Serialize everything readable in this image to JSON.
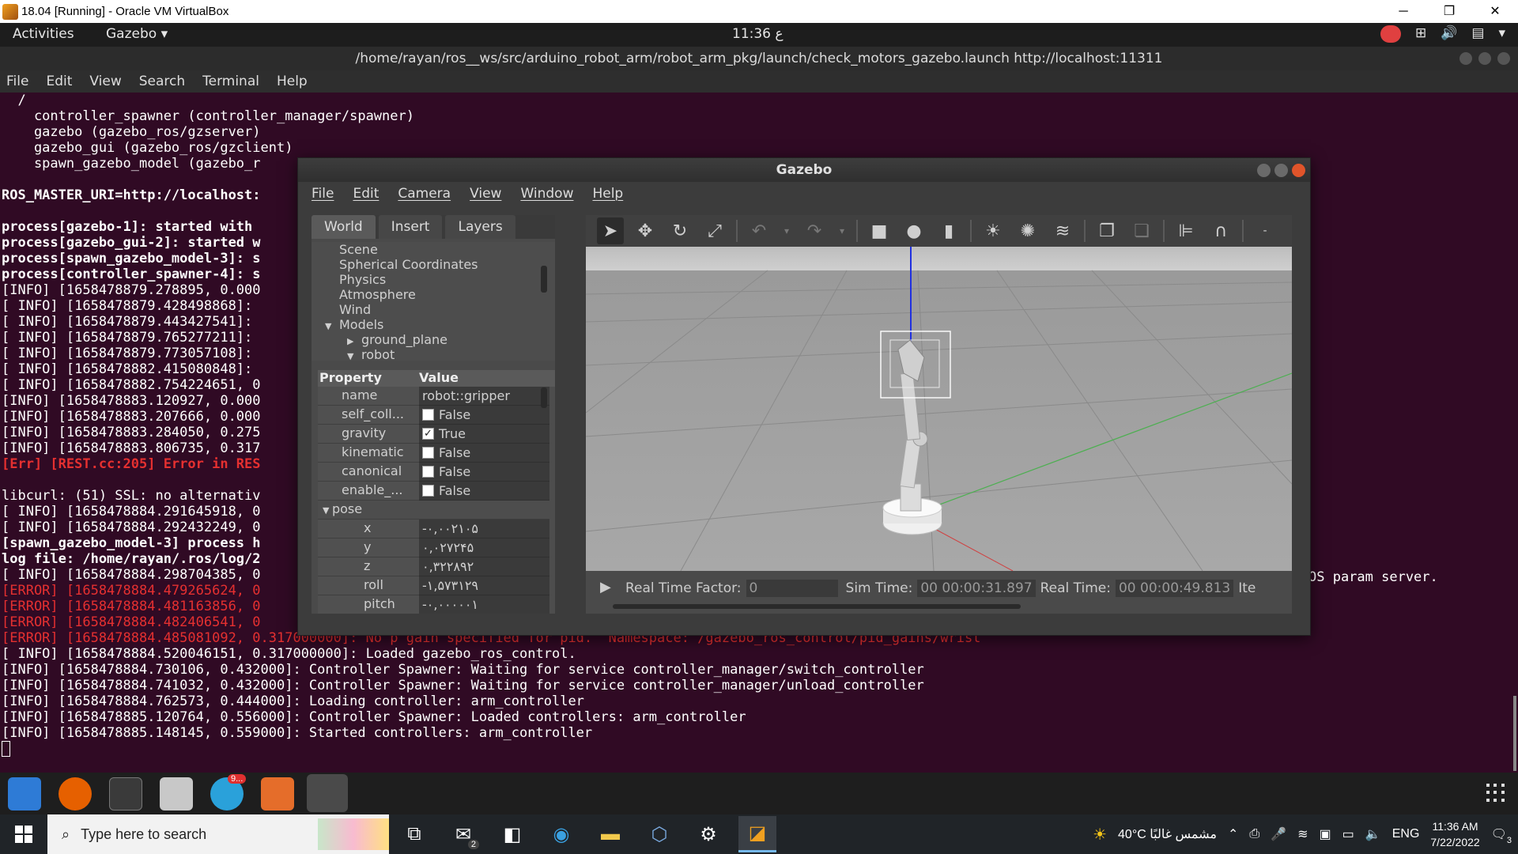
{
  "vbox": {
    "title": "18.04 [Running] - Oracle VM VirtualBox",
    "minimize": "─",
    "restore": "❐",
    "close": "✕"
  },
  "topbar": {
    "activities": "Activities",
    "app_menu": "Gazebo ▾",
    "clock": "11:36 ع",
    "tray_icons": [
      "network-icon",
      "volume-icon",
      "battery-icon",
      "menu-arrow-icon"
    ]
  },
  "terminal": {
    "title": "/home/rayan/ros__ws/src/arduino_robot_arm/robot_arm_pkg/launch/check_motors_gazebo.launch http://localhost:11311",
    "menu": [
      "File",
      "Edit",
      "View",
      "Search",
      "Terminal",
      "Help"
    ],
    "lines": [
      {
        "text": "  /",
        "cls": ""
      },
      {
        "text": "    controller_spawner (controller_manager/spawner)",
        "cls": ""
      },
      {
        "text": "    gazebo (gazebo_ros/gzserver)",
        "cls": ""
      },
      {
        "text": "    gazebo_gui (gazebo_ros/gzclient)",
        "cls": ""
      },
      {
        "text": "    spawn_gazebo_model (gazebo_r",
        "cls": ""
      },
      {
        "text": "",
        "cls": ""
      },
      {
        "text": "ROS_MASTER_URI=http://localhost:",
        "cls": "bold"
      },
      {
        "text": "",
        "cls": ""
      },
      {
        "text": "process[gazebo-1]: started with",
        "cls": "bold"
      },
      {
        "text": "process[gazebo_gui-2]: started w",
        "cls": "bold"
      },
      {
        "text": "process[spawn_gazebo_model-3]: s",
        "cls": "bold"
      },
      {
        "text": "process[controller_spawner-4]: s",
        "cls": "bold"
      },
      {
        "text": "[INFO] [1658478879.278895, 0.000",
        "cls": ""
      },
      {
        "text": "[ INFO] [1658478879.428498868]: ",
        "cls": ""
      },
      {
        "text": "[ INFO] [1658478879.443427541]: ",
        "cls": ""
      },
      {
        "text": "[ INFO] [1658478879.765277211]: ",
        "cls": ""
      },
      {
        "text": "[ INFO] [1658478879.773057108]: ",
        "cls": ""
      },
      {
        "text": "[ INFO] [1658478882.415080848]: ",
        "cls": ""
      },
      {
        "text": "[ INFO] [1658478882.754224651, 0",
        "cls": ""
      },
      {
        "text": "[INFO] [1658478883.120927, 0.000",
        "cls": ""
      },
      {
        "text": "[INFO] [1658478883.207666, 0.000",
        "cls": ""
      },
      {
        "text": "[INFO] [1658478883.284050, 0.275",
        "cls": ""
      },
      {
        "text": "[INFO] [1658478883.806735, 0.317",
        "cls": ""
      },
      {
        "text": "[Err] [REST.cc:205] Error in RES",
        "cls": "err bold"
      },
      {
        "text": "",
        "cls": ""
      },
      {
        "text": "libcurl: (51) SSL: no alternativ",
        "cls": ""
      },
      {
        "text": "[ INFO] [1658478884.291645918, 0",
        "cls": ""
      },
      {
        "text": "[ INFO] [1658478884.292432249, 0",
        "cls": ""
      },
      {
        "text": "[spawn_gazebo_model-3] process h",
        "cls": "bold"
      },
      {
        "text": "log file: /home/rayan/.ros/log/2",
        "cls": "bold"
      },
      {
        "text": "[ INFO] [1658478884.298704385, 0",
        "cls": ""
      },
      {
        "text": "[ERROR] [1658478884.479265624, 0",
        "cls": "err"
      },
      {
        "text": "[ERROR] [1658478884.481163856, 0",
        "cls": "err"
      },
      {
        "text": "[ERROR] [1658478884.482406541, 0",
        "cls": "err"
      },
      {
        "text": "[ERROR] [1658478884.485081092, 0.317000000]: No p gain specified for pid.  Namespace: /gazebo_ros_control/pid_gains/wrist",
        "cls": "err"
      },
      {
        "text": "[ INFO] [1658478884.520046151, 0.317000000]: Loaded gazebo_ros_control.",
        "cls": ""
      },
      {
        "text": "[INFO] [1658478884.730106, 0.432000]: Controller Spawner: Waiting for service controller_manager/switch_controller",
        "cls": ""
      },
      {
        "text": "[INFO] [1658478884.741032, 0.432000]: Controller Spawner: Waiting for service controller_manager/unload_controller",
        "cls": ""
      },
      {
        "text": "[INFO] [1658478884.762573, 0.444000]: Loading controller: arm_controller",
        "cls": ""
      },
      {
        "text": "[INFO] [1658478885.120764, 0.556000]: Controller Spawner: Loaded controllers: arm_controller",
        "cls": ""
      },
      {
        "text": "[INFO] [1658478885.148145, 0.559000]: Started controllers: arm_controller",
        "cls": ""
      }
    ],
    "right_fragment": "OS param server."
  },
  "gazebo": {
    "title": "Gazebo",
    "menu": [
      "File",
      "Edit",
      "Camera",
      "View",
      "Window",
      "Help"
    ],
    "tabs": [
      "World",
      "Insert",
      "Layers"
    ],
    "tree": [
      {
        "label": "Scene",
        "level": 1,
        "arrow": ""
      },
      {
        "label": "Spherical Coordinates",
        "level": 1,
        "arrow": ""
      },
      {
        "label": "Physics",
        "level": 1,
        "arrow": ""
      },
      {
        "label": "Atmosphere",
        "level": 1,
        "arrow": ""
      },
      {
        "label": "Wind",
        "level": 1,
        "arrow": ""
      },
      {
        "label": "Models",
        "level": 1,
        "arrow": "▼"
      },
      {
        "label": "ground_plane",
        "level": 2,
        "arrow": "▶"
      },
      {
        "label": "robot",
        "level": 2,
        "arrow": "▼"
      }
    ],
    "props_header": {
      "property": "Property",
      "value": "Value"
    },
    "props": [
      {
        "key": "name",
        "value": "robot::gripper",
        "checkbox": null,
        "type": "row"
      },
      {
        "key": "self_coll...",
        "value": "False",
        "checkbox": false,
        "type": "row"
      },
      {
        "key": "gravity",
        "value": "True",
        "checkbox": true,
        "type": "row"
      },
      {
        "key": "kinematic",
        "value": "False",
        "checkbox": false,
        "type": "row"
      },
      {
        "key": "canonical",
        "value": "False",
        "checkbox": false,
        "type": "row"
      },
      {
        "key": "enable_...",
        "value": "False",
        "checkbox": false,
        "type": "row"
      },
      {
        "key": "pose",
        "value": "",
        "checkbox": null,
        "type": "group"
      },
      {
        "key": "x",
        "value": "-۰,۰۰۲۱۰۵",
        "checkbox": null,
        "type": "sub"
      },
      {
        "key": "y",
        "value": "۰,۰۲۷۲۴۵",
        "checkbox": null,
        "type": "sub"
      },
      {
        "key": "z",
        "value": "۰,۳۲۲۸۹۲",
        "checkbox": null,
        "type": "sub"
      },
      {
        "key": "roll",
        "value": "-۱,۵۷۳۱۲۹",
        "checkbox": null,
        "type": "sub"
      },
      {
        "key": "pitch",
        "value": "-۰,۰۰۰۰۰۱",
        "checkbox": null,
        "type": "sub"
      }
    ],
    "toolbar": [
      "select-arrow-icon",
      "translate-icon",
      "rotate-icon",
      "scale-icon",
      "undo-icon",
      "redo-icon",
      "box-icon",
      "sphere-icon",
      "cylinder-icon",
      "point-light-icon",
      "spot-light-icon",
      "directional-light-icon",
      "copy-icon",
      "paste-icon",
      "align-icon",
      "snap-icon"
    ],
    "bottom": {
      "rtf_label": "Real Time Factor:",
      "rtf_value": "0",
      "sim_label": "Sim Time:",
      "sim_value": "00 00:00:31.897",
      "real_label": "Real Time:",
      "real_value": "00 00:00:49.813",
      "iter_label": "Ite"
    }
  },
  "dock": {
    "telegram_badge": "9..."
  },
  "taskbar": {
    "search_placeholder": "Type here to search",
    "mail_badge": "2",
    "weather": "40°C مشمس غالبًا",
    "lang": "ENG",
    "time": "11:36 AM",
    "date": "7/22/2022",
    "notif": "3"
  }
}
